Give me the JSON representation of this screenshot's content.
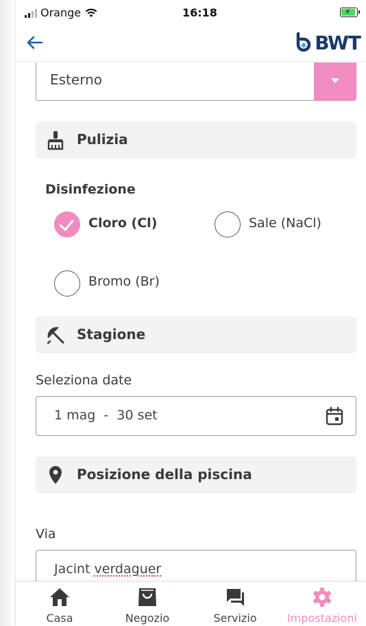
{
  "status_bar": {
    "carrier": "Orange",
    "time": "16:18"
  },
  "header": {
    "logo_text": "BWT",
    "back_icon": "arrow-left-icon"
  },
  "pool_location_select": {
    "value": "Esterno",
    "dropdown_icon": "caret-down-icon"
  },
  "cleaning_section": {
    "title": "Pulizia",
    "icon": "brush-icon"
  },
  "disinfection": {
    "label": "Disinfezione",
    "options": [
      {
        "label": "Cloro (Cl)",
        "selected": true
      },
      {
        "label": "Sale (NaCl)",
        "selected": false
      },
      {
        "label": "Bromo (Br)",
        "selected": false
      }
    ]
  },
  "season_section": {
    "title": "Stagione",
    "icon": "umbrella-icon",
    "date_label": "Seleziona date",
    "date_value": "1 mag  -  30 set",
    "calendar_icon": "calendar-icon"
  },
  "location_section": {
    "title": "Posizione della piscina",
    "icon": "location-pin-icon",
    "street_label": "Via",
    "street_value": "Jacint verdaguer",
    "street_first_word": "Jacint ",
    "street_second_word": "verdaguer"
  },
  "bottom_nav": {
    "items": [
      {
        "label": "Casa",
        "icon": "home-icon"
      },
      {
        "label": "Negozio",
        "icon": "shopping-bag-icon"
      },
      {
        "label": "Servizio",
        "icon": "chat-icon"
      },
      {
        "label": "Impostazioni",
        "icon": "gear-icon"
      }
    ]
  },
  "colors": {
    "accent": "#f08cc0",
    "brand": "#1b3a6b",
    "section_bg": "#f3f3f3"
  }
}
